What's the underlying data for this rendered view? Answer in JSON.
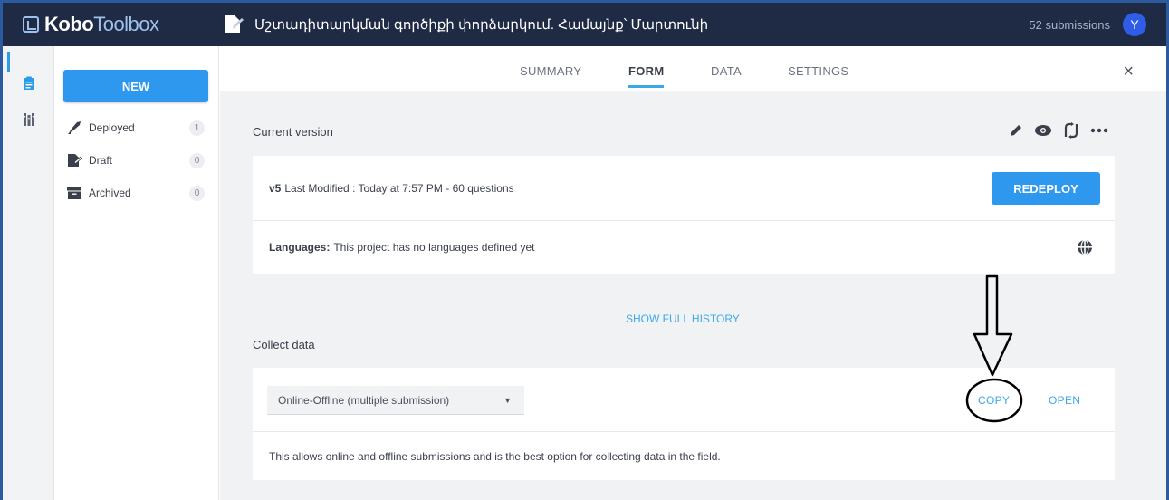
{
  "app": {
    "logo_bold": "Kobo",
    "logo_light": "Toolbox",
    "project_title": "Մշտադիտարկման գործիքի փորձարկում. Համայնք՝ Մարտունի",
    "submissions": "52 submissions",
    "avatar_letter": "Y"
  },
  "sidebar": {
    "new_label": "NEW",
    "items": [
      {
        "label": "Deployed",
        "count": "1"
      },
      {
        "label": "Draft",
        "count": "0"
      },
      {
        "label": "Archived",
        "count": "0"
      }
    ]
  },
  "tabs": [
    {
      "label": "SUMMARY",
      "active": false
    },
    {
      "label": "FORM",
      "active": true
    },
    {
      "label": "DATA",
      "active": false
    },
    {
      "label": "SETTINGS",
      "active": false
    }
  ],
  "close_label": "×",
  "current_version": {
    "heading": "Current version",
    "version": "v5",
    "modified": "Last Modified : Today at 7:57 PM - 60 questions",
    "redeploy_label": "REDEPLOY",
    "languages_label": "Languages:",
    "languages_text": "This project has no languages defined yet",
    "action_icons": [
      "pencil-icon",
      "eye-icon",
      "replace-icon",
      "more-icon"
    ]
  },
  "history_link": "SHOW FULL HISTORY",
  "collect": {
    "heading": "Collect data",
    "selected_option": "Online-Offline (multiple submission)",
    "copy_label": "COPY",
    "open_label": "OPEN",
    "description": "This allows online and offline submissions and is the best option for collecting data in the field."
  },
  "colors": {
    "topbar": "#1f2a44",
    "accent": "#2e97ee",
    "link": "#3ca8e8",
    "avatar": "#2f5de8"
  }
}
